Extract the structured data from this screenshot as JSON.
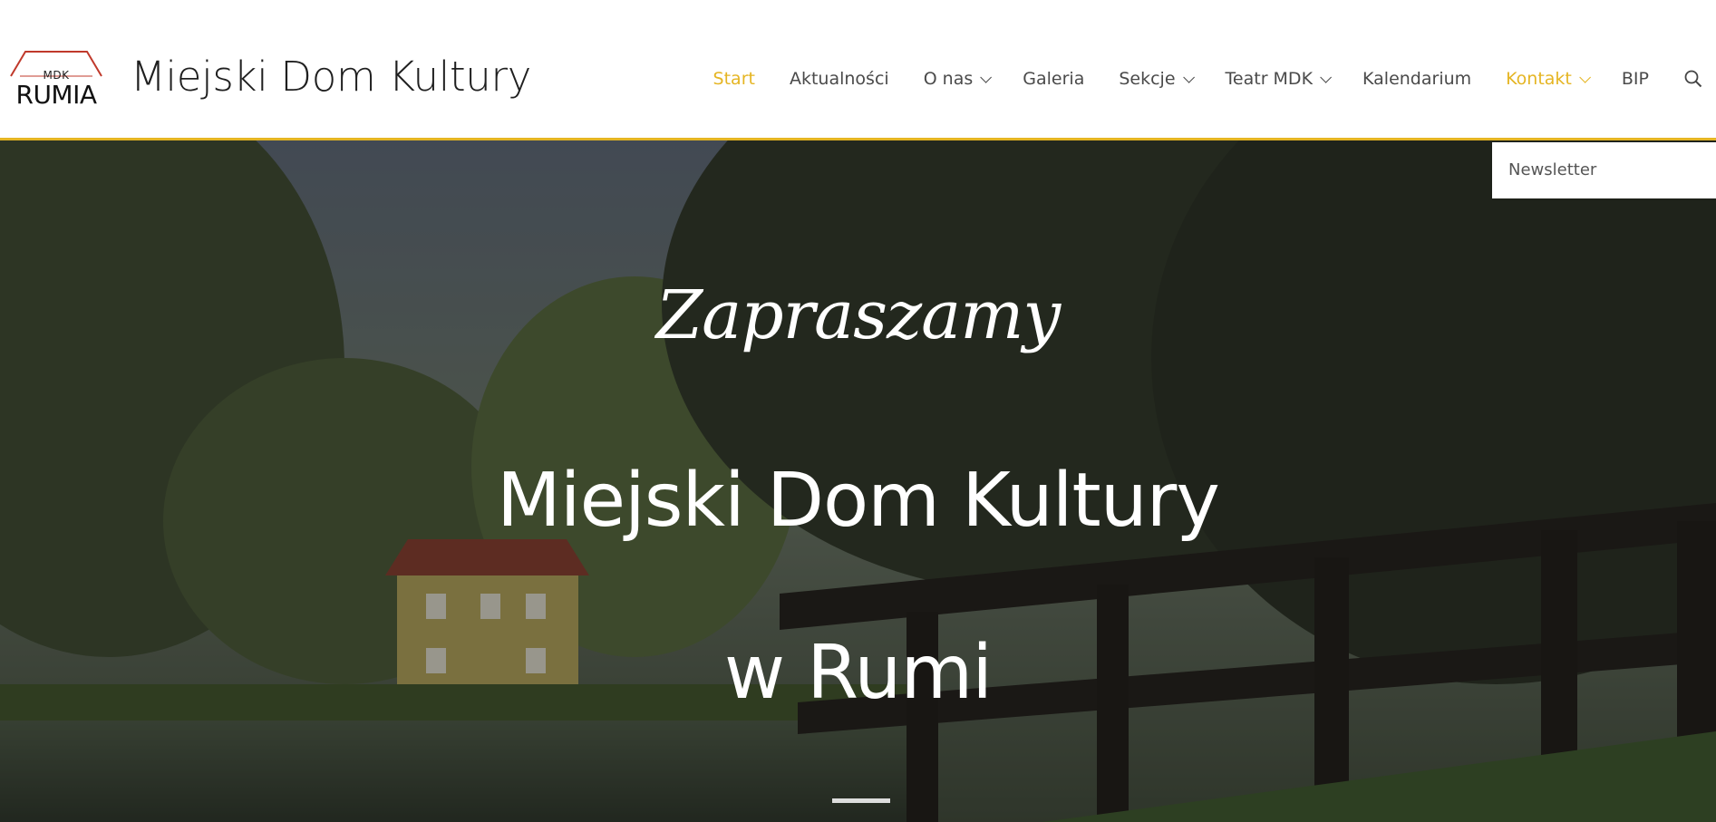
{
  "header": {
    "logo": {
      "small_text": "MDK",
      "big_text": "RUMIA",
      "accent_color": "#c0392b"
    },
    "site_title": "Miejski Dom Kultury",
    "accent_color": "#e5b523"
  },
  "nav": {
    "items": [
      {
        "label": "Start",
        "active": true,
        "has_dropdown": false
      },
      {
        "label": "Aktualności",
        "active": false,
        "has_dropdown": false
      },
      {
        "label": "O nas",
        "active": false,
        "has_dropdown": true
      },
      {
        "label": "Galeria",
        "active": false,
        "has_dropdown": false
      },
      {
        "label": "Sekcje",
        "active": false,
        "has_dropdown": true
      },
      {
        "label": "Teatr MDK",
        "active": false,
        "has_dropdown": true
      },
      {
        "label": "Kalendarium",
        "active": false,
        "has_dropdown": false
      },
      {
        "label": "Kontakt",
        "active": true,
        "has_dropdown": true
      },
      {
        "label": "BIP",
        "active": false,
        "has_dropdown": false
      }
    ],
    "search_icon": "search-icon"
  },
  "dropdown": {
    "items": [
      "Newsletter"
    ]
  },
  "hero": {
    "script_text": "Zapraszamy",
    "title": "Miejski Dom Kultury",
    "subtitle": "w Rumi"
  }
}
